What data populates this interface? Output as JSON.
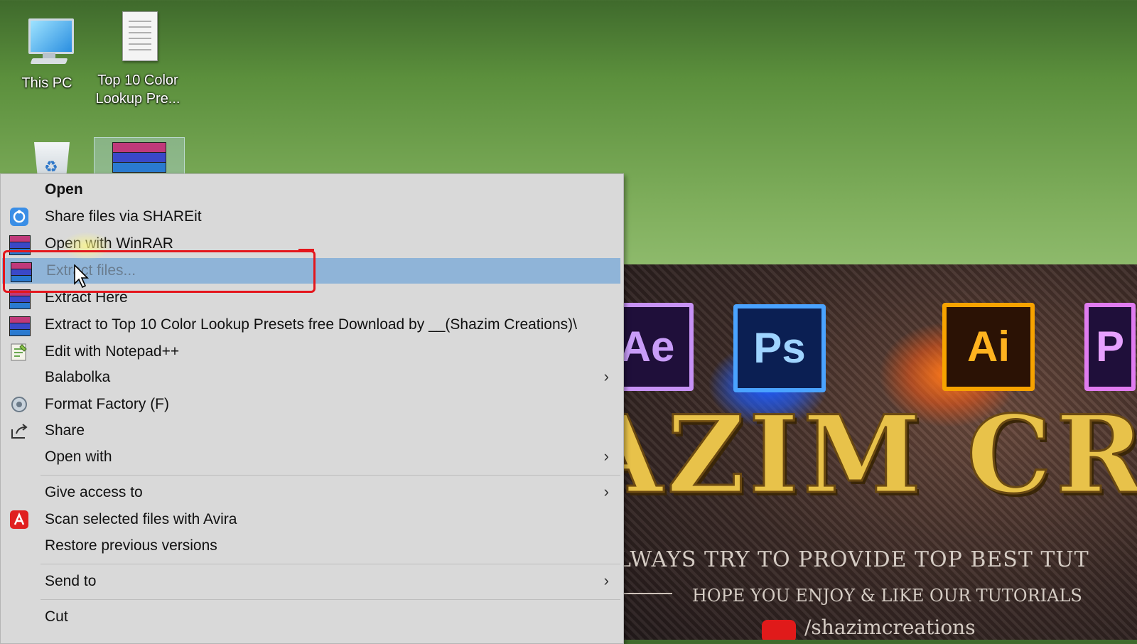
{
  "desktop": {
    "icons": [
      {
        "label": "This PC",
        "icon": "this-pc-icon"
      },
      {
        "label": "Top 10 Color Lookup Pre...",
        "icon": "text-document-icon"
      },
      {
        "label": "",
        "icon": "recycle-bin-icon"
      },
      {
        "label": "",
        "icon": "winrar-archive-icon"
      }
    ]
  },
  "context_menu": {
    "items": [
      {
        "label": "Open",
        "icon": "",
        "bold": true
      },
      {
        "label": "Share files via SHAREit",
        "icon": "shareit-icon"
      },
      {
        "label": "Open with WinRAR",
        "icon": "winrar-icon"
      },
      {
        "label": "Extract files...",
        "icon": "winrar-icon",
        "highlighted": true
      },
      {
        "label": "Extract Here",
        "icon": "winrar-icon"
      },
      {
        "label": "Extract to Top 10 Color Lookup Presets free Download by __(Shazim Creations)\\",
        "icon": "winrar-icon"
      },
      {
        "label": "Edit with Notepad++",
        "icon": "notepad-plus-plus-icon"
      },
      {
        "label": "Balabolka",
        "icon": "",
        "submenu": true
      },
      {
        "label": "Format Factory (F)",
        "icon": "format-factory-icon"
      },
      {
        "label": "Share",
        "icon": "share-icon"
      },
      {
        "label": "Open with",
        "icon": "",
        "submenu": true
      },
      {
        "label": "Give access to",
        "icon": "",
        "submenu": true
      },
      {
        "label": "Scan selected files with Avira",
        "icon": "avira-icon"
      },
      {
        "label": "Restore previous versions",
        "icon": ""
      },
      {
        "label": "Send to",
        "icon": "",
        "submenu": true
      },
      {
        "label": "Cut",
        "icon": ""
      }
    ],
    "submenu_arrow": "›"
  },
  "banner": {
    "apps": [
      "Ae",
      "Ps",
      "Ai",
      "P"
    ],
    "title": "AZIM CREAT",
    "tagline": "LWAYS TRY TO PROVIDE TOP BEST TUT",
    "tagline2": "HOPE YOU ENJOY & LIKE OUR TUTORIALS",
    "channel": "/shazimcreations"
  },
  "colors": {
    "menu_background": "#d9d9d9",
    "highlight": "#8fb4d8",
    "annotation_red": "#e4161c"
  }
}
